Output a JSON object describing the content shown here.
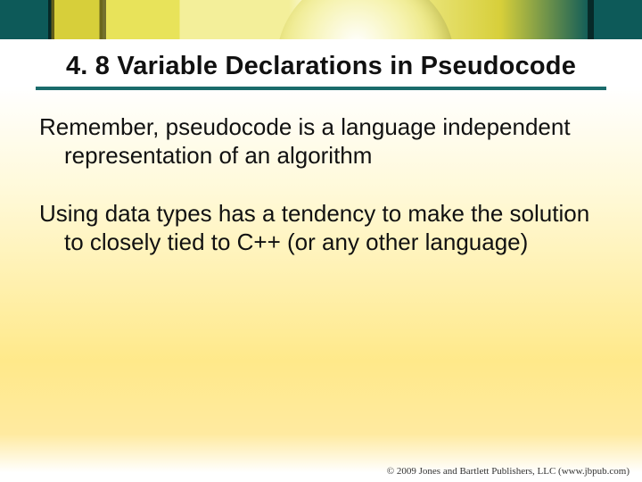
{
  "banner": {
    "alt": "decorative-balloon-banner"
  },
  "title": "4. 8 Variable Declarations in Pseudocode",
  "paragraphs": [
    "Remember, pseudocode is a language independent representation of an algorithm",
    "Using data types has a tendency to make the solution to closely tied to C++ (or any other language)"
  ],
  "footer": "© 2009 Jones and Bartlett Publishers, LLC (www.jbpub.com)"
}
